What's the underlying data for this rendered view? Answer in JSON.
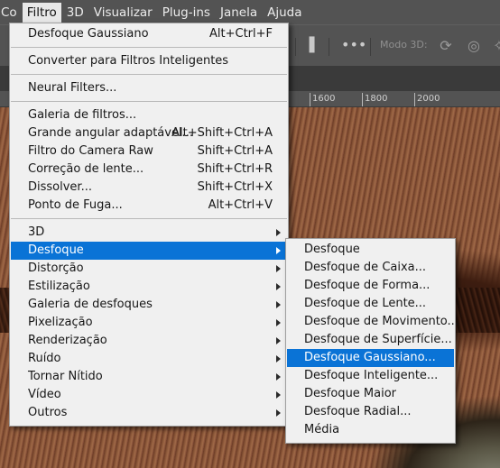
{
  "menubar": [
    "Co",
    "Filtro",
    "3D",
    "Visualizar",
    "Plug-ins",
    "Janela",
    "Ajuda"
  ],
  "menubar_active_index": 1,
  "options_bar": {
    "more_icon": "•••",
    "mode_label": "Modo 3D:",
    "icons": [
      "rotate-3d-icon",
      "orbit-3d-icon"
    ]
  },
  "ruler": {
    "labels": [
      "1600",
      "1800",
      "2000"
    ]
  },
  "filter_menu": {
    "groups": [
      [
        {
          "label": "Desfoque Gaussiano",
          "shortcut": "Alt+Ctrl+F"
        }
      ],
      [
        {
          "label": "Converter para Filtros Inteligentes"
        }
      ],
      [
        {
          "label": "Neural Filters..."
        }
      ],
      [
        {
          "label": "Galeria de filtros..."
        },
        {
          "label": "Grande angular adaptável...",
          "shortcut": "Alt+Shift+Ctrl+A"
        },
        {
          "label": "Filtro do Camera Raw",
          "shortcut": "Shift+Ctrl+A"
        },
        {
          "label": "Correção de lente...",
          "shortcut": "Shift+Ctrl+R"
        },
        {
          "label": "Dissolver...",
          "shortcut": "Shift+Ctrl+X"
        },
        {
          "label": "Ponto de Fuga...",
          "shortcut": "Alt+Ctrl+V"
        }
      ],
      [
        {
          "label": "3D",
          "submenu": true
        },
        {
          "label": "Desfoque",
          "submenu": true,
          "highlighted": true
        },
        {
          "label": "Distorção",
          "submenu": true
        },
        {
          "label": "Estilização",
          "submenu": true
        },
        {
          "label": "Galeria de desfoques",
          "submenu": true
        },
        {
          "label": "Pixelização",
          "submenu": true
        },
        {
          "label": "Renderização",
          "submenu": true
        },
        {
          "label": "Ruído",
          "submenu": true
        },
        {
          "label": "Tornar Nítido",
          "submenu": true
        },
        {
          "label": "Vídeo",
          "submenu": true
        },
        {
          "label": "Outros",
          "submenu": true
        }
      ]
    ]
  },
  "blur_submenu": {
    "items": [
      {
        "label": "Desfoque"
      },
      {
        "label": "Desfoque de Caixa..."
      },
      {
        "label": "Desfoque de Forma..."
      },
      {
        "label": "Desfoque de Lente..."
      },
      {
        "label": "Desfoque de Movimento..."
      },
      {
        "label": "Desfoque de Superfície..."
      },
      {
        "label": "Desfoque Gaussiano...",
        "highlighted": true
      },
      {
        "label": "Desfoque Inteligente..."
      },
      {
        "label": "Desfoque Maior"
      },
      {
        "label": "Desfoque Radial..."
      },
      {
        "label": "Média"
      }
    ]
  },
  "colors": {
    "highlight": "#0a73d6",
    "menu_bg": "#f0f0f0",
    "app_chrome": "#535353"
  }
}
